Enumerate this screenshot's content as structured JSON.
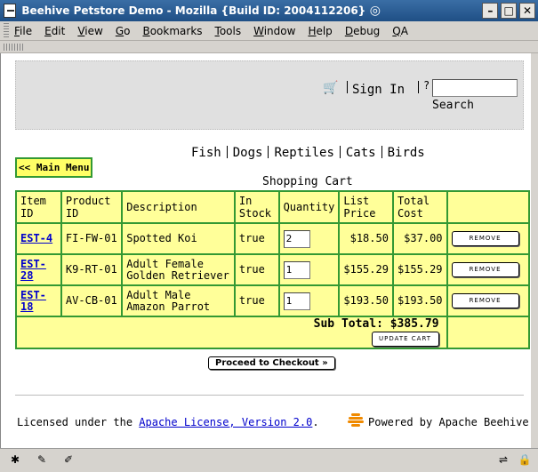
{
  "window": {
    "title": "Beehive Petstore Demo - Mozilla {Build ID: 2004112206}",
    "buttons": [
      "–",
      "□",
      "✕"
    ]
  },
  "menubar": {
    "items": [
      "File",
      "Edit",
      "View",
      "Go",
      "Bookmarks",
      "Tools",
      "Window",
      "Help",
      "Debug",
      "QA"
    ]
  },
  "header": {
    "sign_in": "Sign In",
    "help": "?",
    "search_label": "Search",
    "search_value": ""
  },
  "categories": [
    "Fish",
    "Dogs",
    "Reptiles",
    "Cats",
    "Birds"
  ],
  "main_menu_label": "<< Main Menu",
  "cart": {
    "title": "Shopping Cart",
    "headers": [
      "Item ID",
      "Product ID",
      "Description",
      "In Stock",
      "Quantity",
      "List Price",
      "Total Cost",
      ""
    ],
    "rows": [
      {
        "item_id": "EST-4",
        "product_id": "FI-FW-01",
        "description": "Spotted Koi",
        "in_stock": "true",
        "quantity": "2",
        "list_price": "$18.50",
        "total_cost": "$37.00",
        "action": "REMOVE"
      },
      {
        "item_id": "EST-28",
        "product_id": "K9-RT-01",
        "description": "Adult Female Golden Retriever",
        "in_stock": "true",
        "quantity": "1",
        "list_price": "$155.29",
        "total_cost": "$155.29",
        "action": "REMOVE"
      },
      {
        "item_id": "EST-18",
        "product_id": "AV-CB-01",
        "description": "Adult Male Amazon Parrot",
        "in_stock": "true",
        "quantity": "1",
        "list_price": "$193.50",
        "total_cost": "$193.50",
        "action": "REMOVE"
      }
    ],
    "subtotal_label": "Sub Total: $385.79",
    "update_label": "UPDATE CART"
  },
  "checkout_label": "Proceed to Checkout »",
  "footer": {
    "license_prefix": "Licensed under the ",
    "license_link": "Apache License, Version 2.0",
    "license_suffix": ".",
    "powered_by": "Powered by Apache Beehive"
  },
  "colors": {
    "title_bar": "#1f4f85",
    "cart_bg": "#ffff99",
    "cart_border": "#339933",
    "link": "#0000cc",
    "beehive_logo": "#f08a00"
  }
}
